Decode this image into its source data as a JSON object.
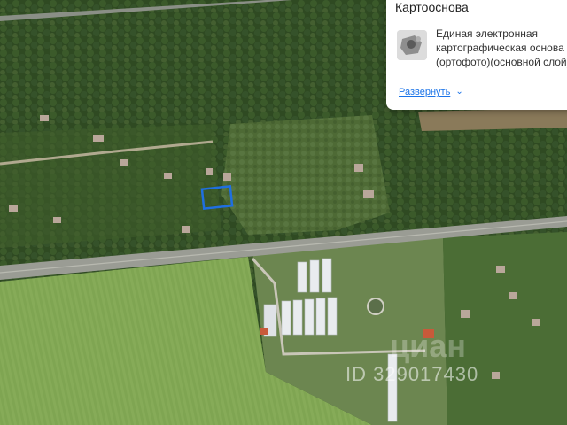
{
  "panel": {
    "title": "Картооснова",
    "layer_lines": [
      "Единая электронная",
      "картографическая основа",
      "(ортофото)(основной слой)"
    ],
    "expand_label": "Развернуть"
  },
  "watermark": {
    "id_text": "ID 329017430",
    "logo_text": "циан"
  },
  "icons": [
    "layer-thumbnail-icon",
    "chevron-down-icon"
  ],
  "colors": {
    "selection_outline": "#1f6fe0",
    "link": "#1a73e8"
  }
}
